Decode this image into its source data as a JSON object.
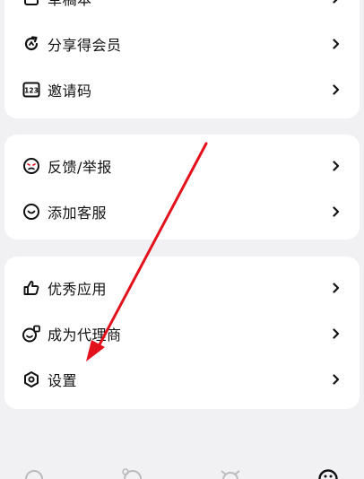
{
  "colors": {
    "background": "#f1f1f3",
    "card": "#ffffff",
    "text": "#111111",
    "arrow": "#e3111c"
  },
  "group1": {
    "items": [
      {
        "label": "草稿本",
        "icon": "draft-icon"
      },
      {
        "label": "分享得会员",
        "icon": "refresh-share-icon"
      },
      {
        "label": "邀请码",
        "icon": "code-123-icon"
      }
    ]
  },
  "group2": {
    "items": [
      {
        "label": "反馈/举报",
        "icon": "feedback-face-icon"
      },
      {
        "label": "添加客服",
        "icon": "customer-service-chat-icon"
      }
    ]
  },
  "group3": {
    "items": [
      {
        "label": "优秀应用",
        "icon": "thumbs-up-icon"
      },
      {
        "label": "成为代理商",
        "icon": "agent-icon"
      },
      {
        "label": "设置",
        "icon": "settings-hexagon-icon"
      }
    ]
  },
  "tabbar": {
    "tabs": [
      {
        "icon": "tab-home-icon"
      },
      {
        "icon": "tab-character-icon"
      },
      {
        "icon": "tab-mascot-icon"
      },
      {
        "icon": "tab-profile-icon"
      }
    ]
  }
}
